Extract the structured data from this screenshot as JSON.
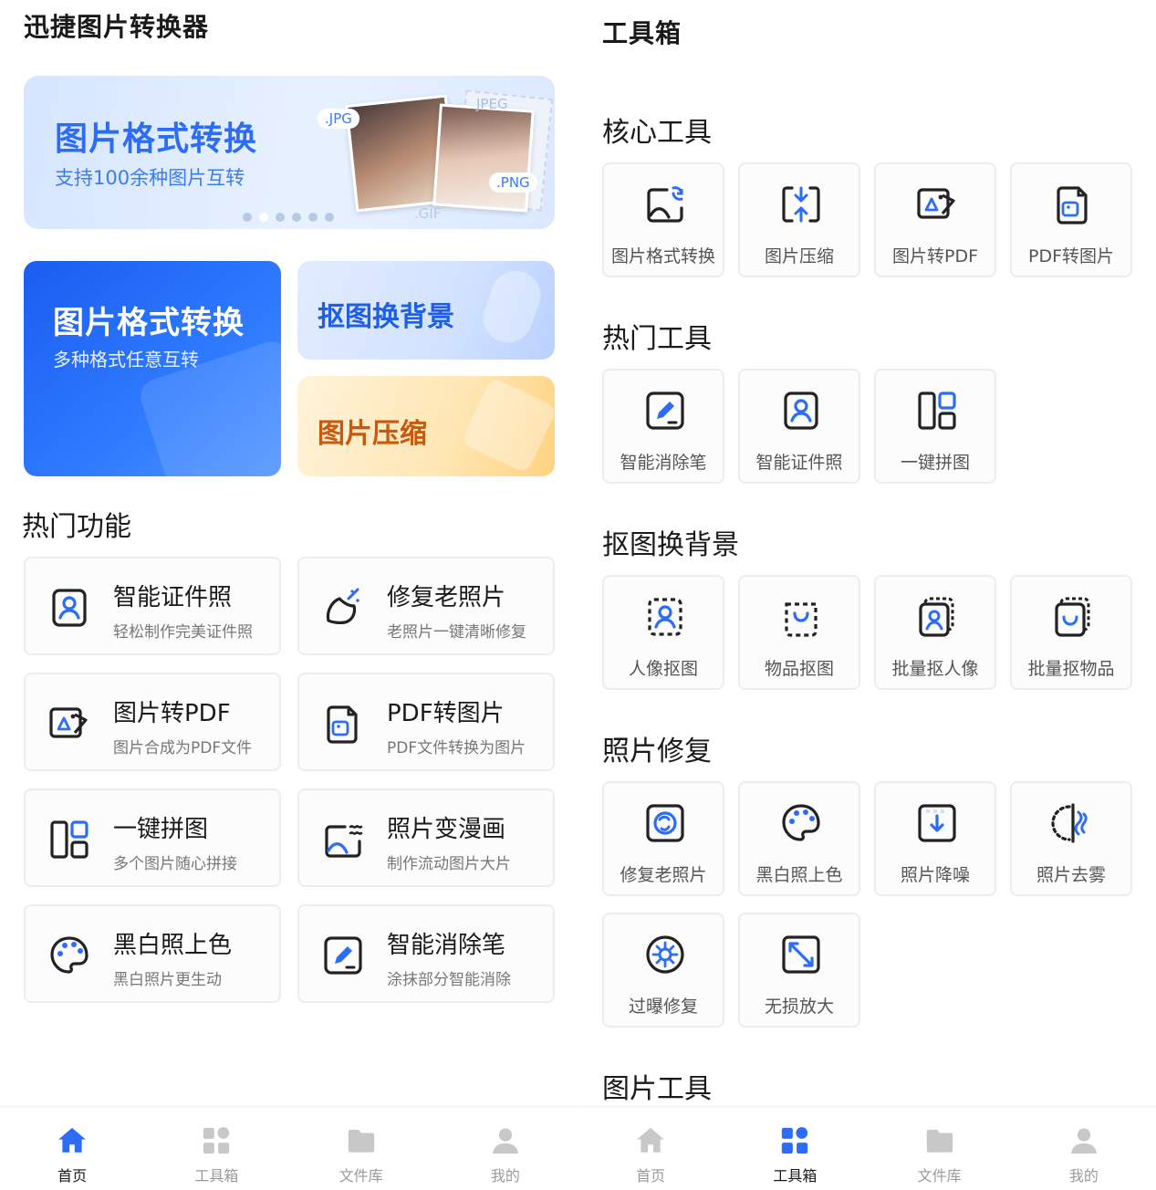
{
  "colors": {
    "accent": "#2d6df6",
    "icon_dark": "#222222",
    "nav_inactive": "#c8c8c8",
    "orange_text": "#c9590e"
  },
  "home": {
    "app_title": "迅捷图片转换器",
    "banner": {
      "title": "图片格式转换",
      "subtitle": "支持100余种图片互转",
      "tags": {
        "jpg": ".JPG",
        "jpeg": "JPEG",
        "png": ".PNG",
        "gif": ".GIF"
      },
      "active_dot": 2,
      "dot_count": 6
    },
    "promo": {
      "big_title": "图片格式转换",
      "big_subtitle": "多种格式任意互转",
      "cutout_title": "抠图换背景",
      "compress_title": "图片压缩"
    },
    "hot_section_title": "热门功能",
    "features": [
      {
        "title": "智能证件照",
        "subtitle": "轻松制作完美证件照",
        "icon": "id-photo-icon"
      },
      {
        "title": "修复老照片",
        "subtitle": "老照片一键清晰修复",
        "icon": "magic-repair-icon"
      },
      {
        "title": "图片转PDF",
        "subtitle": "图片合成为PDF文件",
        "icon": "image-to-pdf-icon"
      },
      {
        "title": "PDF转图片",
        "subtitle": "PDF文件转换为图片",
        "icon": "pdf-to-image-icon"
      },
      {
        "title": "一键拼图",
        "subtitle": "多个图片随心拼接",
        "icon": "collage-icon"
      },
      {
        "title": "照片变漫画",
        "subtitle": "制作流动图片大片",
        "icon": "photo-to-cartoon-icon"
      },
      {
        "title": "黑白照上色",
        "subtitle": "黑白照片更生动",
        "icon": "palette-icon"
      },
      {
        "title": "智能消除笔",
        "subtitle": "涂抹部分智能消除",
        "icon": "eraser-pen-icon"
      }
    ],
    "nav": [
      {
        "label": "首页",
        "icon": "home-icon",
        "active": true
      },
      {
        "label": "工具箱",
        "icon": "toolbox-icon",
        "active": false
      },
      {
        "label": "文件库",
        "icon": "folder-icon",
        "active": false
      },
      {
        "label": "我的",
        "icon": "user-icon",
        "active": false
      }
    ]
  },
  "tools": {
    "title": "工具箱",
    "sections": [
      {
        "title": "核心工具",
        "items": [
          {
            "label": "图片格式转换",
            "icon": "image-convert-icon"
          },
          {
            "label": "图片压缩",
            "icon": "compress-icon"
          },
          {
            "label": "图片转PDF",
            "icon": "image-to-pdf-icon"
          },
          {
            "label": "PDF转图片",
            "icon": "pdf-to-image-icon"
          }
        ]
      },
      {
        "title": "热门工具",
        "items": [
          {
            "label": "智能消除笔",
            "icon": "eraser-pen-icon"
          },
          {
            "label": "智能证件照",
            "icon": "id-photo-icon"
          },
          {
            "label": "一键拼图",
            "icon": "collage-icon"
          }
        ]
      },
      {
        "title": "抠图换背景",
        "items": [
          {
            "label": "人像抠图",
            "icon": "portrait-cutout-icon"
          },
          {
            "label": "物品抠图",
            "icon": "object-cutout-icon"
          },
          {
            "label": "批量抠人像",
            "icon": "batch-portrait-icon"
          },
          {
            "label": "批量抠物品",
            "icon": "batch-object-icon"
          }
        ]
      },
      {
        "title": "照片修复",
        "items": [
          {
            "label": "修复老照片",
            "icon": "restore-photo-icon"
          },
          {
            "label": "黑白照上色",
            "icon": "palette-icon"
          },
          {
            "label": "照片降噪",
            "icon": "denoise-icon"
          },
          {
            "label": "照片去雾",
            "icon": "dehaze-icon"
          },
          {
            "label": "过曝修复",
            "icon": "overexposure-icon"
          },
          {
            "label": "无损放大",
            "icon": "enlarge-icon"
          }
        ]
      },
      {
        "title": "图片工具",
        "items": []
      }
    ],
    "nav": [
      {
        "label": "首页",
        "icon": "home-icon",
        "active": false
      },
      {
        "label": "工具箱",
        "icon": "toolbox-icon",
        "active": true
      },
      {
        "label": "文件库",
        "icon": "folder-icon",
        "active": false
      },
      {
        "label": "我的",
        "icon": "user-icon",
        "active": false
      }
    ]
  }
}
